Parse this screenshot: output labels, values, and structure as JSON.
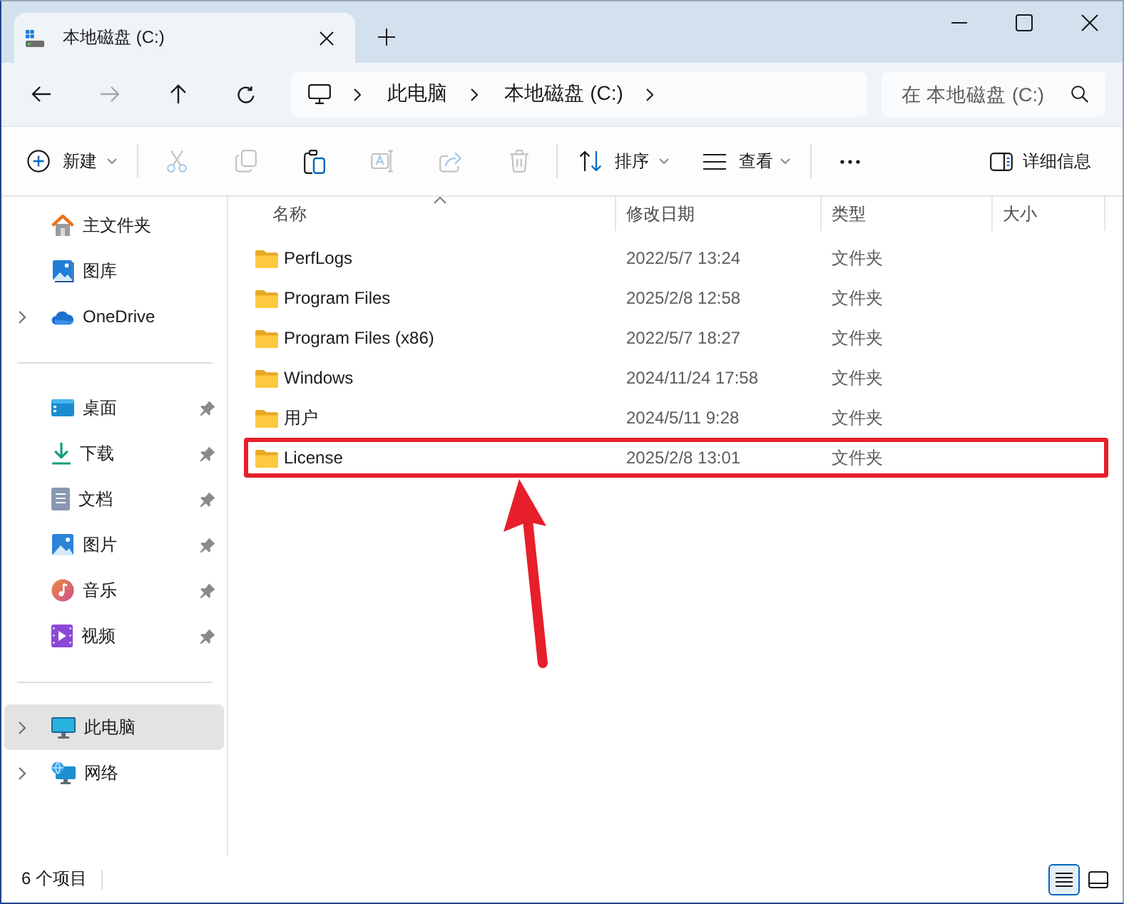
{
  "tabs": [
    {
      "title": "本地磁盘 (C:)",
      "selected": true
    }
  ],
  "navigation": [
    {
      "kind": "back",
      "disabled": false
    },
    {
      "kind": "forward",
      "disabled": true
    },
    {
      "kind": "up",
      "disabled": false
    },
    {
      "kind": "refresh",
      "disabled": false
    }
  ],
  "address_bar": {
    "breadcrumbs": [
      "此电脑",
      "本地磁盘 (C:)"
    ]
  },
  "search": {
    "placeholder": "在 本地磁盘 (C:)"
  },
  "toolbar": {
    "new_button": {
      "label": "新建"
    },
    "actions": [
      {
        "kind": "cut",
        "disabled": true
      },
      {
        "kind": "copy",
        "disabled": true
      },
      {
        "kind": "paste",
        "disabled": false
      },
      {
        "kind": "rename",
        "disabled": true
      },
      {
        "kind": "share",
        "disabled": true
      },
      {
        "kind": "delete",
        "disabled": true
      }
    ],
    "sort_button": {
      "label": "排序"
    },
    "view_button": {
      "label": "查看"
    },
    "details_button": {
      "label": "详细信息"
    }
  },
  "sidebar": {
    "groups": [
      {
        "items": [
          {
            "label": "主文件夹",
            "kind": "home",
            "expandable": false,
            "pinned": false,
            "selected": false
          },
          {
            "label": "图库",
            "kind": "gallery",
            "expandable": false,
            "pinned": false,
            "selected": false
          },
          {
            "label": "OneDrive",
            "kind": "onedrive",
            "expandable": true,
            "pinned": false,
            "selected": false
          }
        ]
      },
      {
        "items": [
          {
            "label": "桌面",
            "kind": "desktop",
            "expandable": false,
            "pinned": true,
            "selected": false
          },
          {
            "label": "下载",
            "kind": "downloads",
            "expandable": false,
            "pinned": true,
            "selected": false
          },
          {
            "label": "文档",
            "kind": "documents",
            "expandable": false,
            "pinned": true,
            "selected": false
          },
          {
            "label": "图片",
            "kind": "pictures",
            "expandable": false,
            "pinned": true,
            "selected": false
          },
          {
            "label": "音乐",
            "kind": "music",
            "expandable": false,
            "pinned": true,
            "selected": false
          },
          {
            "label": "视频",
            "kind": "videos",
            "expandable": false,
            "pinned": true,
            "selected": false
          }
        ]
      },
      {
        "items": [
          {
            "label": "此电脑",
            "kind": "this_pc",
            "expandable": true,
            "pinned": false,
            "selected": true
          },
          {
            "label": "网络",
            "kind": "network",
            "expandable": true,
            "pinned": false,
            "selected": false
          }
        ]
      }
    ]
  },
  "file_list": {
    "columns": [
      {
        "label": "名称",
        "sorted": true
      },
      {
        "label": "修改日期",
        "sorted": false
      },
      {
        "label": "类型",
        "sorted": false
      },
      {
        "label": "大小",
        "sorted": false
      }
    ],
    "rows": [
      {
        "name": "PerfLogs",
        "modified": "2022/5/7 13:24",
        "type": "文件夹",
        "highlighted": false
      },
      {
        "name": "Program Files",
        "modified": "2025/2/8 12:58",
        "type": "文件夹",
        "highlighted": false
      },
      {
        "name": "Program Files (x86)",
        "modified": "2022/5/7 18:27",
        "type": "文件夹",
        "highlighted": false
      },
      {
        "name": "Windows",
        "modified": "2024/11/24 17:58",
        "type": "文件夹",
        "highlighted": false
      },
      {
        "name": "用户",
        "modified": "2024/5/11 9:28",
        "type": "文件夹",
        "highlighted": false
      },
      {
        "name": "License",
        "modified": "2025/2/8 13:01",
        "type": "文件夹",
        "highlighted": true
      }
    ]
  },
  "status_bar": {
    "item_count": "6 个项目",
    "views": [
      {
        "kind": "details",
        "selected": true
      },
      {
        "kind": "tiles",
        "selected": false
      }
    ]
  }
}
